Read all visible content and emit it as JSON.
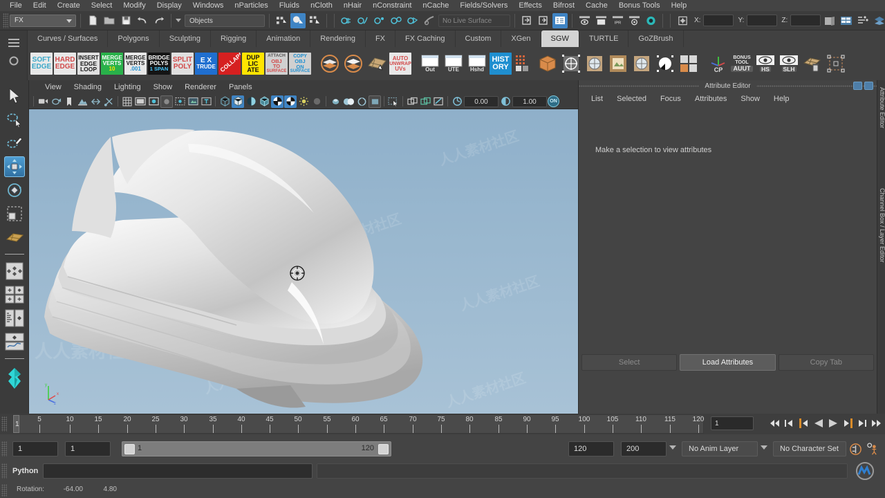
{
  "app": {
    "title": "Autodesk Maya"
  },
  "menubar": {
    "items": [
      "File",
      "Edit",
      "Create",
      "Select",
      "Modify",
      "Display",
      "Windows",
      "nParticles",
      "Fluids",
      "nCloth",
      "nHair",
      "nConstraint",
      "nCache",
      "Fields/Solvers",
      "Effects",
      "Bifrost",
      "Cache",
      "Bonus Tools",
      "Help"
    ]
  },
  "status_line": {
    "menuset_value": "FX",
    "object_field_value": "Objects",
    "live_surface_value": "No Live Surface",
    "coord_labels": {
      "x": "X:",
      "y": "Y:",
      "z": "Z:"
    },
    "coord_values": {
      "x": "",
      "y": "",
      "z": ""
    },
    "icons": {
      "new": "new-scene-icon",
      "open": "open-scene-icon",
      "save": "save-scene-icon",
      "undo": "undo-icon",
      "redo": "redo-icon",
      "select_hierarchy": "select-by-hierarchy-icon",
      "select_object": "select-by-object-type-icon",
      "select_component": "select-by-component-type-icon",
      "snap_grid": "snap-to-grid-icon",
      "snap_curve": "snap-to-curve-icon",
      "snap_point": "snap-to-point-icon",
      "snap_projected": "snap-to-projected-center-icon",
      "snap_view": "snap-to-view-plane-icon",
      "make_live": "make-live-icon",
      "open_editor": "show-hide-editors-icon",
      "attr_editor": "attribute-editor-toggle-icon",
      "render_current": "render-current-frame-icon",
      "render_seq": "render-sequence-icon",
      "ipr": "ipr-render-icon",
      "render_settings": "render-settings-icon",
      "hypershade": "hypershade-icon",
      "no_sel_mask": "no-selection-mask-icon",
      "sidebar_a": "show-attribute-editor-icon",
      "sidebar_b": "show-tool-settings-icon",
      "sidebar_c": "show-channel-box-icon",
      "sidebar_d": "show-layer-editor-icon"
    }
  },
  "shelf": {
    "tabs": [
      "Curves / Surfaces",
      "Polygons",
      "Sculpting",
      "Rigging",
      "Animation",
      "Rendering",
      "FX",
      "FX Caching",
      "Custom",
      "XGen",
      "SGW",
      "TURTLE",
      "GoZBrush"
    ],
    "active_tab": "SGW",
    "buttons": [
      {
        "name": "soft-edge",
        "lines": [
          "SOFT",
          "EDGE"
        ],
        "bg": "#e8e8e8",
        "fg": "#3aa8c8",
        "size": 10
      },
      {
        "name": "hard-edge",
        "lines": [
          "HARD",
          "EDGE"
        ],
        "bg": "#e8e8e8",
        "fg": "#d24a4a",
        "size": 10
      },
      {
        "name": "insert-edge-loop",
        "lines": [
          "INSERT",
          "EDGE",
          "LOOP"
        ],
        "bg": "#e0e0e0",
        "fg": "#1a1a1a",
        "size": 8
      },
      {
        "name": "merge-verts-10",
        "lines": [
          "MERGE",
          "VERTS",
          "10"
        ],
        "bg": "#29b14a",
        "fg": "#ffffff",
        "size": 8,
        "lastfg": "#ffe400"
      },
      {
        "name": "merge-verts-001",
        "lines": [
          "MERGE",
          "VERTS",
          ".001"
        ],
        "bg": "#e8e8e8",
        "fg": "#1a1a1a",
        "size": 8,
        "lastfg": "#1f8fd0"
      },
      {
        "name": "bridge-polys-1span",
        "lines": [
          "BRIDGE",
          "POLYS",
          "1 SPAN"
        ],
        "bg": "#141414",
        "fg": "#ffffff",
        "size": 8,
        "lastfg": "#48c9ff"
      },
      {
        "name": "split-poly",
        "lines": [
          "SPLIT",
          "POLY"
        ],
        "bg": "#e0e0e0",
        "fg": "#d24a4a",
        "size": 10
      },
      {
        "name": "extrude",
        "lines": [
          "E X",
          "TRUDE"
        ],
        "bg": "#1f6fd0",
        "fg": "#ffffff",
        "size": 9
      },
      {
        "name": "collapse",
        "lines": [
          "COLLAPSE"
        ],
        "bg": "#d62020",
        "fg": "#ffffff",
        "size": 9,
        "rotate": true
      },
      {
        "name": "duplicate",
        "lines": [
          "DUP",
          "LIC",
          "ATE"
        ],
        "bg": "#ffe400",
        "fg": "#111111",
        "size": 9
      },
      {
        "name": "attach-obj-to-surface",
        "lines": [
          "ATTACH",
          "OBJ",
          "TO",
          "SURFACE"
        ],
        "bg": "#d0d0d0",
        "fg": "#d24a4a",
        "size": 7
      },
      {
        "name": "copy-obj-on-surface",
        "lines": [
          "COPY",
          "OBJ",
          "ON",
          "SURFACE"
        ],
        "bg": "#d0d0d0",
        "fg": "#1f8fd0",
        "size": 7
      },
      {
        "name": "combine-mesh",
        "icon": "combine-layers-icon"
      },
      {
        "name": "separate-mesh",
        "icon": "separate-layers-icon"
      },
      {
        "name": "uv-layout",
        "icon": "uv-editor-icon"
      },
      {
        "name": "auto-unwrap-uvs",
        "lines": [
          "AUTO",
          "UNWRAP",
          "UVs"
        ],
        "bg": "#e8e8e8",
        "fg": "#d24a4a",
        "size": 8
      },
      {
        "name": "outliner",
        "lines": [
          "Out"
        ],
        "icon": "window-outliner-icon"
      },
      {
        "name": "ute-window",
        "lines": [
          "UTE"
        ],
        "icon": "window-ute-icon"
      },
      {
        "name": "hypershade-window",
        "lines": [
          "Hshd"
        ],
        "icon": "window-hypershade-icon"
      },
      {
        "name": "delete-history",
        "lines": [
          "HIST",
          "ORY"
        ],
        "bg": "#1f8fd0",
        "fg": "#ffffff",
        "size": 11
      },
      {
        "name": "grid-display",
        "icon": "grid-icon"
      },
      {
        "name": "cube-primitive",
        "icon": "cube-icon"
      },
      {
        "name": "transform-center-a",
        "icon": "transform-pivot-icon"
      },
      {
        "name": "transform-center-b",
        "icon": "transform-pivot-alt-icon"
      },
      {
        "name": "texture-plane",
        "icon": "texture-plane-icon"
      },
      {
        "name": "shading-sphere",
        "icon": "shading-sphere-icon"
      },
      {
        "name": "contrast-sphere",
        "icon": "contrast-sphere-icon"
      },
      {
        "name": "quad-swatch",
        "icon": "quad-color-swatch-icon"
      },
      {
        "name": "center-pivot",
        "lines": [
          "CP"
        ],
        "icon": "axis-tripod-icon"
      },
      {
        "name": "bonus-tool-auut",
        "lines": [
          "BONUS",
          "TOOL",
          "AUUT"
        ],
        "bg": "transparent",
        "fg": "#e0e0e0",
        "size": 7
      },
      {
        "name": "hide-selected",
        "lines": [
          "HS"
        ],
        "icon": "eye-icon"
      },
      {
        "name": "show-last-hidden",
        "lines": [
          "SLH"
        ],
        "icon": "eye-icon"
      },
      {
        "name": "delete-uv-set",
        "icon": "uv-trash-icon"
      },
      {
        "name": "bounding-box",
        "icon": "bounding-box-icon"
      }
    ]
  },
  "toolbox": {
    "items": [
      {
        "name": "select-tool",
        "icon": "arrow-cursor-icon",
        "selected": false
      },
      {
        "name": "lasso-select-tool",
        "icon": "lasso-select-icon",
        "selected": false
      },
      {
        "name": "paint-select-tool",
        "icon": "paint-select-icon",
        "selected": false
      },
      {
        "name": "move-tool",
        "icon": "move-arrows-icon",
        "selected": true
      },
      {
        "name": "rotate-tool",
        "icon": "rotate-ring-icon",
        "selected": false
      },
      {
        "name": "scale-tool",
        "icon": "scale-box-icon",
        "selected": false
      },
      {
        "name": "last-tool-used",
        "icon": "last-tool-icon",
        "selected": false
      },
      {
        "name": "layout-single-pane",
        "icon": "single-pane-icon",
        "selected": false
      },
      {
        "name": "layout-four-pane",
        "icon": "four-pane-icon",
        "selected": false
      },
      {
        "name": "layout-outliner-persp",
        "icon": "outliner-persp-icon",
        "selected": false
      },
      {
        "name": "layout-persp-graph",
        "icon": "persp-graph-icon",
        "selected": false
      }
    ]
  },
  "viewport": {
    "menus": [
      "View",
      "Shading",
      "Lighting",
      "Show",
      "Renderer",
      "Panels"
    ],
    "toolbar": {
      "exposure_value": "0.00",
      "gamma_value": "1.00",
      "color_mgmt_toggle": "ON",
      "icons": [
        "select-camera-icon",
        "lock-camera-icon",
        "bookmark-icon",
        "image-plane-icon",
        "two-sided-lighting-icon",
        "gate-mask-icon",
        "grid-toggle-icon",
        "film-gate-icon",
        "resolution-gate-icon",
        "field-chart-icon",
        "safe-action-icon",
        "safe-title-icon",
        "text-overlay-icon",
        "wireframe-icon",
        "smooth-shade-icon",
        "flat-shade-icon",
        "shaded-wireframe-icon",
        "textured-icon",
        "use-default-light-icon",
        "shadows-icon",
        "ambient-occlusion-icon",
        "motion-blur-icon",
        "multisample-icon",
        "depth-of-field-icon",
        "isolate-select-icon",
        "xray-icon",
        "xray-joints-icon",
        "xray-active-components-icon",
        "exposure-icon",
        "gamma-icon"
      ]
    },
    "background_top": "#8fb0ca",
    "background_bottom": "#a8c2d6",
    "model_name": "boat-hull-mesh",
    "axis_labels": {
      "x": "x",
      "y": "y",
      "z": "z"
    },
    "manipulator": "rotate-manipulator-icon",
    "watermark_text": "人人素材社区"
  },
  "attribute_editor": {
    "title": "Attribute Editor",
    "menus": [
      "List",
      "Selected",
      "Focus",
      "Attributes",
      "Show",
      "Help"
    ],
    "empty_message": "Make a selection to view attributes",
    "buttons": [
      {
        "label": "Select",
        "enabled": false
      },
      {
        "label": "Load Attributes",
        "enabled": true
      },
      {
        "label": "Copy Tab",
        "enabled": false
      }
    ],
    "side_tabs": [
      "Attribute Editor",
      "Channel Box / Layer Editor"
    ]
  },
  "timeline": {
    "start": 1,
    "end": 120,
    "current_frame": "1",
    "tick_labels": [
      5,
      10,
      15,
      20,
      25,
      30,
      35,
      40,
      45,
      50,
      55,
      60,
      65,
      70,
      75,
      80,
      85,
      90,
      95,
      100,
      105,
      110,
      115,
      120
    ],
    "playback_buttons": [
      "go-to-start-icon",
      "step-back-frame-icon",
      "step-back-key-icon",
      "play-backwards-icon",
      "play-forwards-icon",
      "step-forward-key-icon",
      "step-forward-frame-icon",
      "go-to-end-icon"
    ]
  },
  "range_slider": {
    "anim_start": "1",
    "anim_end": "1",
    "range_start": "1",
    "range_end": "120",
    "playback_end": "120",
    "anim_end_total": "200",
    "anim_layer": "No Anim Layer",
    "character_set": "No Character Set",
    "icons": [
      "auto-key-icon",
      "animation-preferences-icon"
    ]
  },
  "command_line": {
    "language_label": "Python",
    "input_value": "",
    "output_value": "",
    "logo": "maya-logo-icon"
  },
  "help_line": {
    "label": "Rotation:",
    "value_1": "-64.00",
    "value_2": "4.80"
  },
  "colors": {
    "accent_blue": "#3f84c4",
    "panel_bg": "#444444",
    "dark_bg": "#2d2d2d",
    "text": "#c8c8c8",
    "selected_tool": "#4f9fd4"
  }
}
